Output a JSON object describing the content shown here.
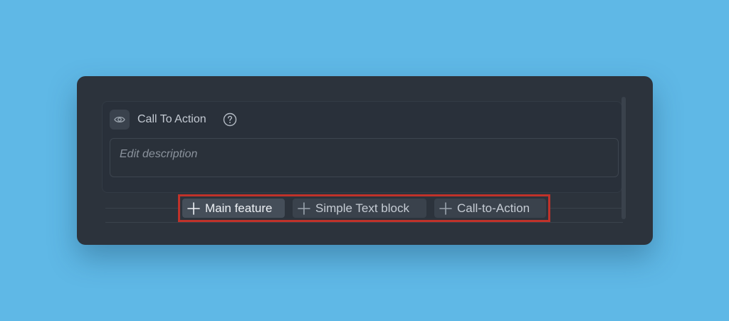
{
  "block": {
    "title": "Call To Action",
    "visibility_icon": "eye-icon",
    "help_icon": "question-circle-icon",
    "description_placeholder": "Edit description"
  },
  "add_buttons": [
    {
      "label": "Main feature",
      "icon": "plus-icon"
    },
    {
      "label": "Simple Text block",
      "icon": "plus-icon"
    },
    {
      "label": "Call-to-Action",
      "icon": "plus-icon"
    }
  ],
  "colors": {
    "background": "#5fb8e6",
    "card": "#2c333c",
    "highlight_border": "#c0322a"
  }
}
